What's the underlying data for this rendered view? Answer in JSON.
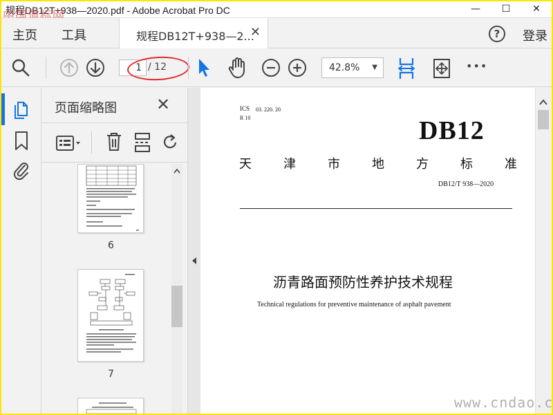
{
  "window": {
    "title": "规程DB12T+938—2020.pdf - Adobe Acrobat Pro DC",
    "watermark_logo": "中国道标网",
    "minimize": "—",
    "maximize": "☐",
    "close": "✕"
  },
  "menu": {
    "home": "主页",
    "tools": "工具",
    "doc_tab_label": "规程DB12T+938—2...",
    "doc_tab_close": "✕",
    "help": "?",
    "sign_in": "登录"
  },
  "toolbar": {
    "current_page": "1",
    "page_total": "/ 12",
    "zoom": "42.8%",
    "more": "•••"
  },
  "thumbnails": {
    "title": "页面缩略图",
    "close": "✕",
    "pages": [
      {
        "number": "6"
      },
      {
        "number": "7"
      }
    ]
  },
  "document": {
    "ics": "ICS",
    "ics_code": "03. 220. 20",
    "r": "R 10",
    "db_title": "DB12",
    "region_chars": [
      "天",
      "津",
      "市",
      "地",
      "方",
      "标",
      "准"
    ],
    "std_number": "DB12/T 938—2020",
    "title_cn": "沥青路面预防性养护技术规程",
    "title_en": "Technical regulations for preventive maintenance of asphalt pavement"
  },
  "watermark": {
    "url": "www.cndao.com"
  },
  "colors": {
    "accent_blue": "#1473e6",
    "annotation_red": "#e12a2a",
    "frame_yellow": "#ffe400"
  }
}
